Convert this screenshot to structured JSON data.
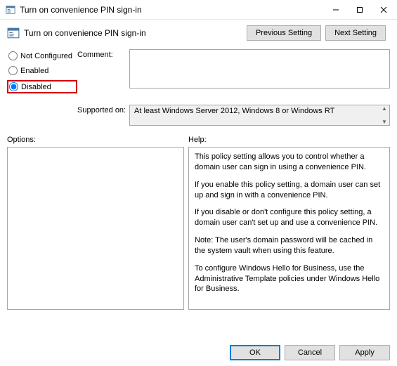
{
  "window": {
    "title": "Turn on convenience PIN sign-in"
  },
  "header": {
    "policy_title": "Turn on convenience PIN sign-in",
    "previous_setting": "Previous Setting",
    "next_setting": "Next Setting"
  },
  "state": {
    "not_configured_label": "Not Configured",
    "enabled_label": "Enabled",
    "disabled_label": "Disabled",
    "selected": "disabled"
  },
  "comment": {
    "label": "Comment:",
    "value": ""
  },
  "supported": {
    "label": "Supported on:",
    "text": "At least Windows Server 2012, Windows 8 or Windows RT"
  },
  "panels": {
    "options_label": "Options:",
    "help_label": "Help:"
  },
  "help": {
    "p1": "This policy setting allows you to control whether a domain user can sign in using a convenience PIN.",
    "p2": "If you enable this policy setting, a domain user can set up and sign in with a convenience PIN.",
    "p3": "If you disable or don't configure this policy setting, a domain user can't set up and use a convenience PIN.",
    "p4": "Note: The user's domain password will be cached in the system vault when using this feature.",
    "p5": "To configure Windows Hello for Business, use the Administrative Template policies under Windows Hello for Business."
  },
  "footer": {
    "ok": "OK",
    "cancel": "Cancel",
    "apply": "Apply"
  }
}
